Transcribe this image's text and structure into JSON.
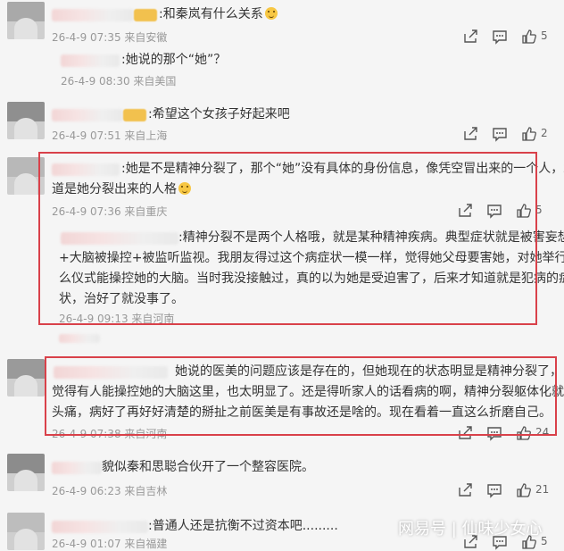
{
  "comments": [
    {
      "text": ":和秦岚有什么关系",
      "meta": "26-4-9 07:35 来自安徽",
      "likes": "5",
      "reply": {
        "text": ":她说的那个“她”？",
        "meta": "26-4-9 08:30 来自美国"
      }
    },
    {
      "text": ":希望这个女孩子好起来吧",
      "meta": "26-4-9 07:51 来自上海",
      "likes": "2"
    },
    {
      "lines": [
        ":她是不是精神分裂了，那个“她”没有具体的身份信息，像凭空冒出来的一个人，难",
        "道是她分裂出来的人格"
      ],
      "meta": "26-4-9 07:36 来自重庆",
      "likes": "5",
      "reply": {
        "lines": [
          ":精神分裂不是两个人格哦，就是某种精神疾病。典型症状就是被害妄想",
          "+大脑被操控+被监听监视。我朋友得过这个病症状一模一样，觉得她父母要害她，对她举行什",
          "么仪式能操控她的大脑。当时我没接触过，真的以为她是受迫害了，后来才知道就是犯病的症",
          "状，治好了就没事了。"
        ],
        "meta": "26-4-9 09:13 来自河南"
      }
    },
    {
      "lines": [
        "她说的医美的问题应该是存在的，但她现在的状态明显是精神分裂了，",
        "觉得有人能操控她的大脑这里，也太明显了。还是得听家人的话看病的啊，精神分裂躯体化就会",
        "头痛，病好了再好好清楚的掰扯之前医美是有事故还是啥的。现在看着一直这么折磨自己。"
      ],
      "meta": "26-4-9 07:38 来自河南",
      "likes": "24"
    },
    {
      "text": "貌似秦和思聪合伙开了一个整容医院。",
      "meta": "26-4-9 06:23 来自吉林",
      "likes": "21"
    },
    {
      "text": ":普通人还是抗衡不过资本吧.........",
      "meta": "26-4-9 01:07 来自福建",
      "likes": "5"
    }
  ],
  "watermark": "网易号 | 仙味少女心",
  "icons": [
    "share-icon",
    "comment-icon",
    "like-icon"
  ],
  "colors": {
    "highlight_box": "#d9414a",
    "meta_text": "#999999"
  }
}
